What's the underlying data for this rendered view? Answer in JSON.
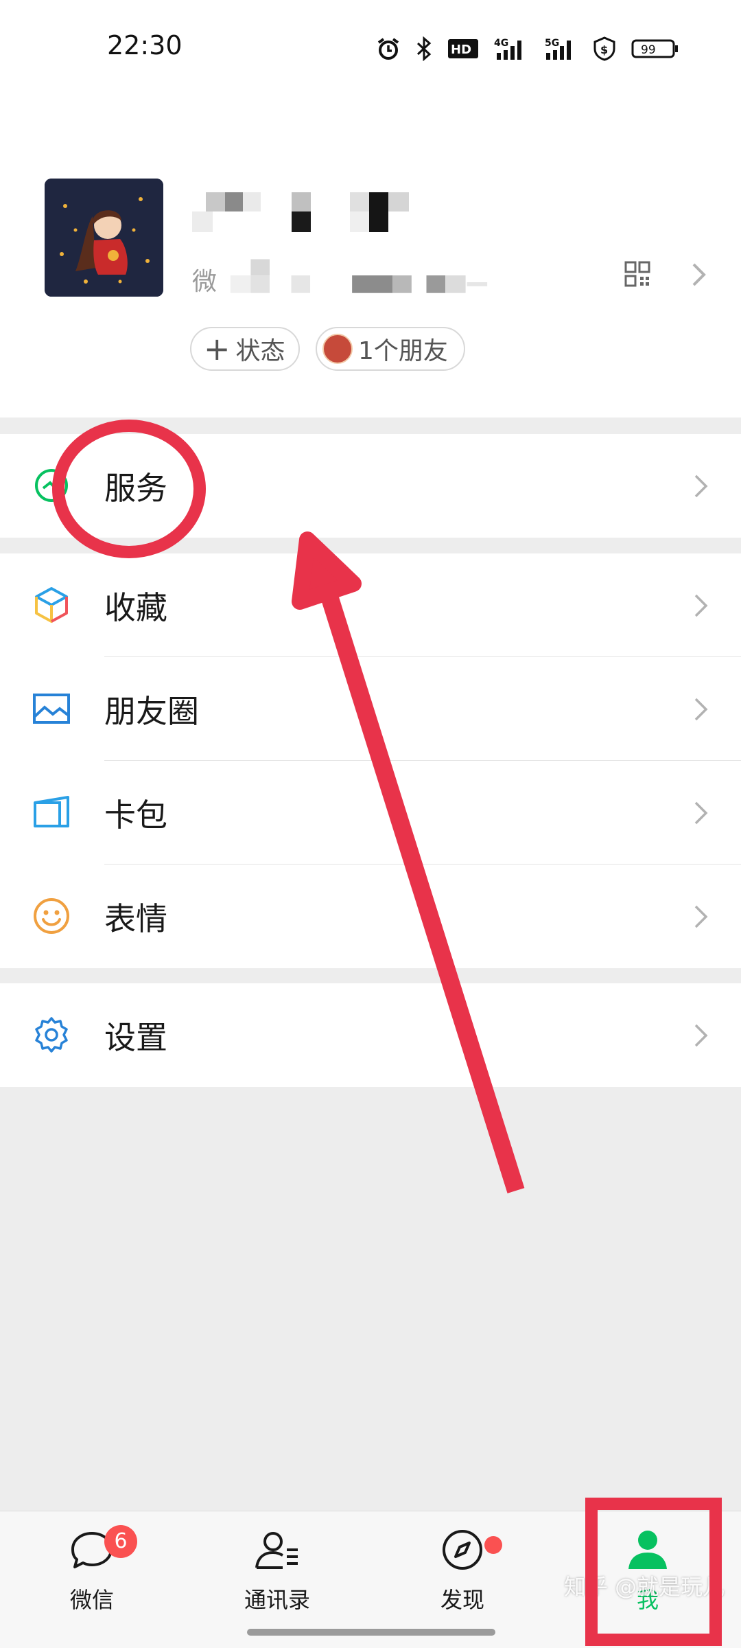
{
  "status_bar": {
    "time": "22:30",
    "network_4g": "4G",
    "network_5g": "5G",
    "hd": "HD",
    "battery": "99"
  },
  "profile": {
    "wechat_id_prefix": "微",
    "status_chip": "状态",
    "status_plus": "+",
    "friends_chip": "1个朋友"
  },
  "menu": {
    "services": "服务",
    "favorites": "收藏",
    "moments": "朋友圈",
    "cards": "卡包",
    "stickers": "表情",
    "settings": "设置"
  },
  "tabbar": {
    "chats": {
      "label": "微信",
      "badge": "6"
    },
    "contacts": {
      "label": "通讯录"
    },
    "discover": {
      "label": "发现"
    },
    "me": {
      "label": "我"
    }
  },
  "watermark": "知乎 @就是玩儿",
  "colors": {
    "accent_green": "#07c160",
    "badge_red": "#fa5151",
    "annotation_red": "#e8334a"
  }
}
